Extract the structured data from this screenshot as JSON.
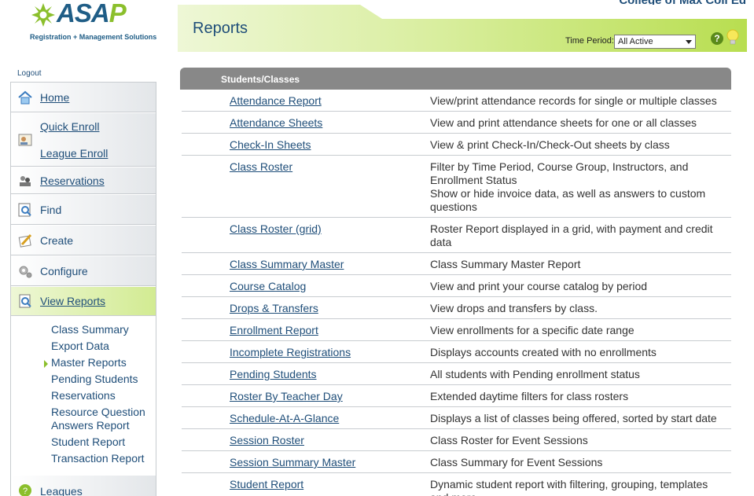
{
  "header": {
    "org_name": "College of Max Coll Ed",
    "title": "Reports",
    "time_period_label": "Time Period:",
    "time_period_value": "All Active"
  },
  "logo": {
    "text_main": "ASA",
    "text_p": "P",
    "tagline": "Registration + Management Solutions"
  },
  "sidebar": {
    "logout": "Logout",
    "items": [
      {
        "label": "Home",
        "icon": "home-icon"
      },
      {
        "label": "Quick Enroll",
        "icon": "enroll-icon"
      },
      {
        "label": "League Enroll",
        "icon": "enroll-icon"
      },
      {
        "label": "Reservations",
        "icon": "reservations-icon"
      },
      {
        "label": "Find",
        "icon": "find-icon"
      },
      {
        "label": "Create",
        "icon": "create-icon"
      },
      {
        "label": "Configure",
        "icon": "configure-icon"
      },
      {
        "label": "View Reports",
        "icon": "reports-icon"
      },
      {
        "label": "Leagues",
        "icon": "leagues-icon"
      }
    ],
    "sub_items": [
      "Class Summary",
      "Export Data",
      "Master Reports",
      "Pending Students",
      "Reservations",
      "Resource Question",
      "Answers Report",
      "Student Report",
      "Transaction Report"
    ]
  },
  "section": {
    "title": "Students/Classes"
  },
  "reports": [
    {
      "name": "Attendance Report",
      "desc": "View/print attendance records for single or multiple classes"
    },
    {
      "name": "Attendance Sheets",
      "desc": "View and print attendance sheets for one or all classes"
    },
    {
      "name": "Check-In Sheets",
      "desc": "View & print Check-In/Check-Out sheets by class"
    },
    {
      "name": "Class Roster",
      "desc": "Filter by Time Period, Course Group, Instructors, and Enrollment Status",
      "desc2": "Show or hide invoice data, as well as answers to custom questions"
    },
    {
      "name": "Class Roster (grid)",
      "desc": "Roster Report displayed in a grid, with payment and credit data"
    },
    {
      "name": "Class Summary Master",
      "desc": "Class Summary Master Report"
    },
    {
      "name": "Course Catalog",
      "desc": "View and print your course catalog by period"
    },
    {
      "name": "Drops & Transfers",
      "desc": "View drops and transfers by class."
    },
    {
      "name": "Enrollment Report",
      "desc": "View enrollments for a specific date range"
    },
    {
      "name": "Incomplete Registrations",
      "desc": "Displays accounts created with no enrollments"
    },
    {
      "name": "Pending Students",
      "desc": "All students with Pending enrollment status"
    },
    {
      "name": "Roster By Teacher Day",
      "desc": "Extended daytime filters for class rosters"
    },
    {
      "name": "Schedule-At-A-Glance",
      "desc": "Displays a list of classes being offered, sorted by start date"
    },
    {
      "name": "Session Roster",
      "desc": "Class Roster for Event Sessions"
    },
    {
      "name": "Session Summary Master",
      "desc": "Class Summary for Event Sessions"
    },
    {
      "name": "Student Report",
      "desc": "Dynamic student report with filtering, grouping, templates and more"
    }
  ]
}
